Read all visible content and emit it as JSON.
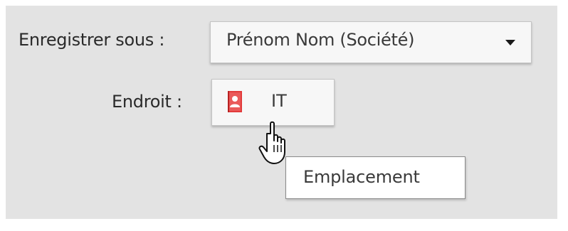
{
  "form": {
    "save_as_label": "Enregistrer sous :",
    "save_as_value": "Prénom Nom (Société)",
    "location_label": "Endroit :",
    "location_value": "IT"
  },
  "icons": {
    "dropdown": "chevron-down-icon",
    "location": "contacts-book-icon",
    "cursor": "hand-pointer-icon"
  },
  "tooltip": {
    "text": "Emplacement"
  },
  "colors": {
    "panel_background": "#e3e3e3",
    "control_background": "#f7f7f7",
    "contacts_icon": "#e23b3b"
  }
}
